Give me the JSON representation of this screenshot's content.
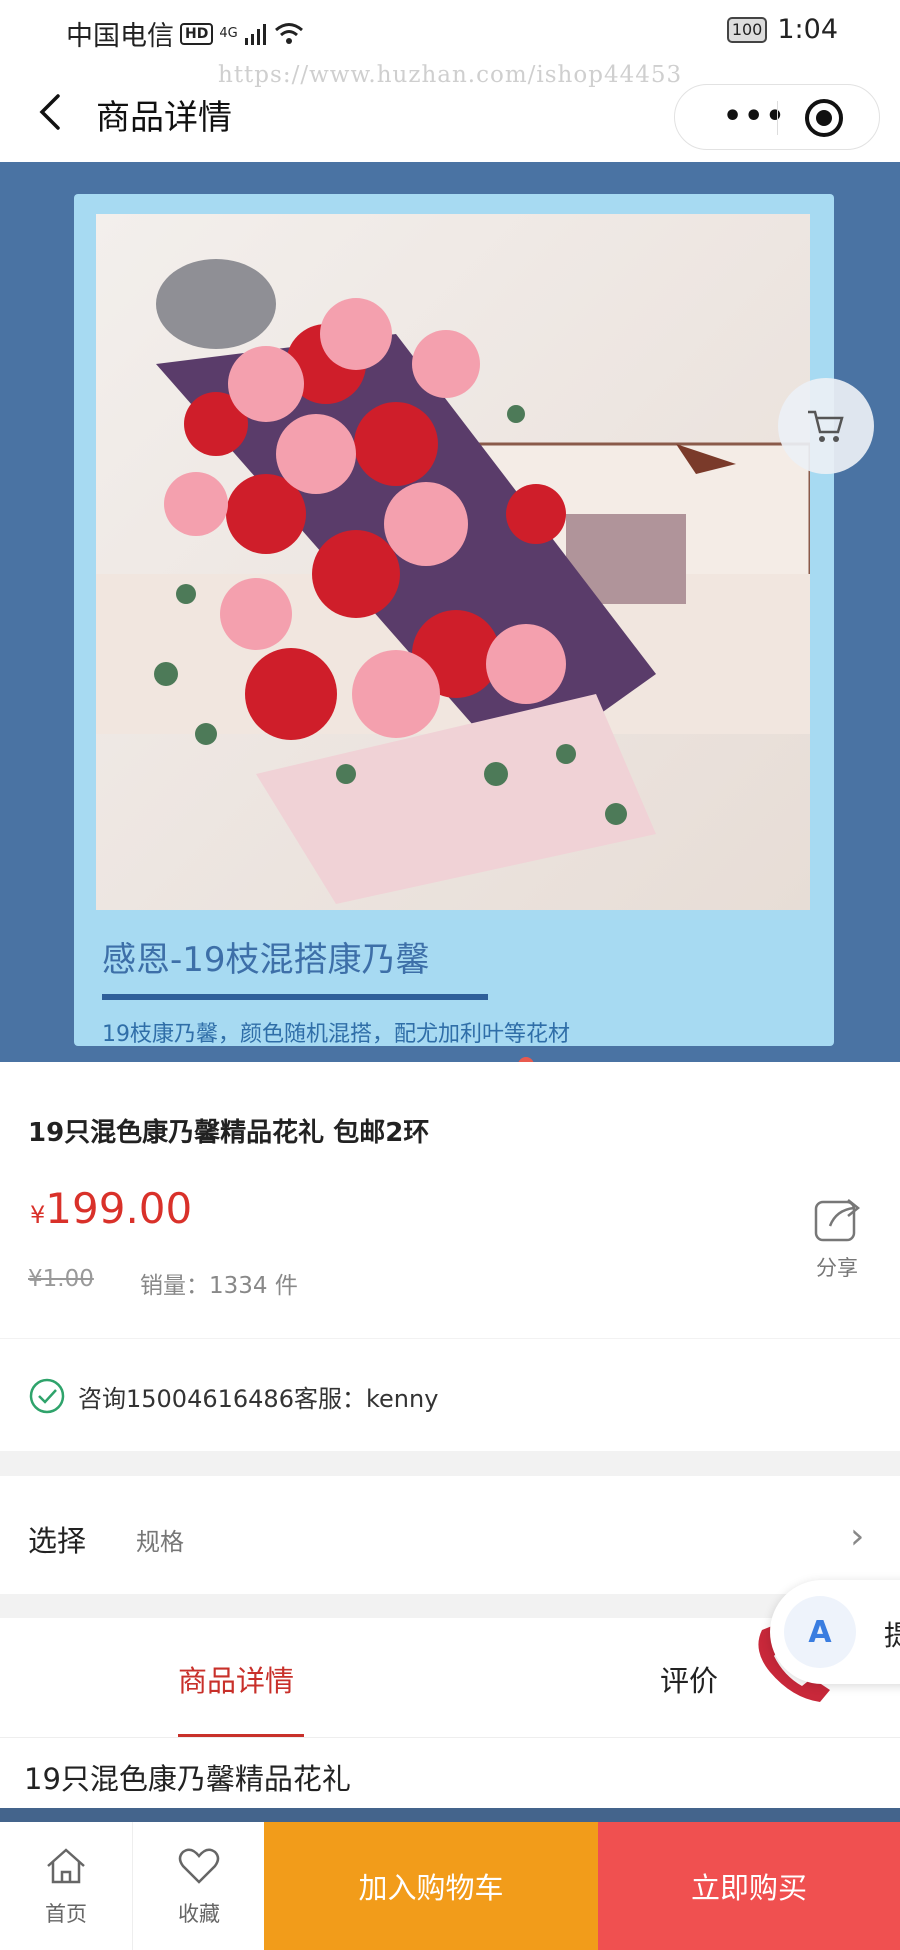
{
  "status_bar": {
    "carrier": "中国电信",
    "hd": "HD",
    "network": "4G",
    "battery": "100",
    "time": "1:04"
  },
  "nav": {
    "title": "商品详情",
    "menu_icon": "more-dots-icon",
    "close_icon": "target-circle-icon",
    "back_icon": "chevron-left-icon"
  },
  "watermark": "https://www.huzhan.com/ishop44453",
  "banner": {
    "caption": "感恩-19枝混搭康乃馨",
    "subcaption": "19枝康乃馨，颜色随机混搭，配尤加利叶等花材",
    "image_alt": "carnation bouquet with gift box",
    "slide_count": 1,
    "active_slide": 1
  },
  "product": {
    "title": "19只混色康乃馨精品花礼 包邮2环",
    "currency": "¥",
    "price": "199.00",
    "original_price": "¥1.00",
    "sales_text": "销量：1334 件",
    "share_label": "分享"
  },
  "consult": {
    "text": "咨询15004616486客服：kenny"
  },
  "spec": {
    "label": "选择",
    "value": "规格",
    "arrow": "›"
  },
  "tabs": [
    {
      "label": "商品详情",
      "active": true
    },
    {
      "label": "评价",
      "active": false
    }
  ],
  "translate_float": {
    "icon": "A",
    "label": "提"
  },
  "detail": {
    "title": "19只混色康乃馨精品花礼"
  },
  "bottom_bar": {
    "home_label": "首页",
    "fav_label": "收藏",
    "cart_button": "加入购物车",
    "buy_button": "立即购买"
  },
  "colors": {
    "accent_red": "#d9312a",
    "cart_orange": "#f29c1a",
    "buy_red": "#f05050",
    "banner_blue": "#4a73a3"
  }
}
